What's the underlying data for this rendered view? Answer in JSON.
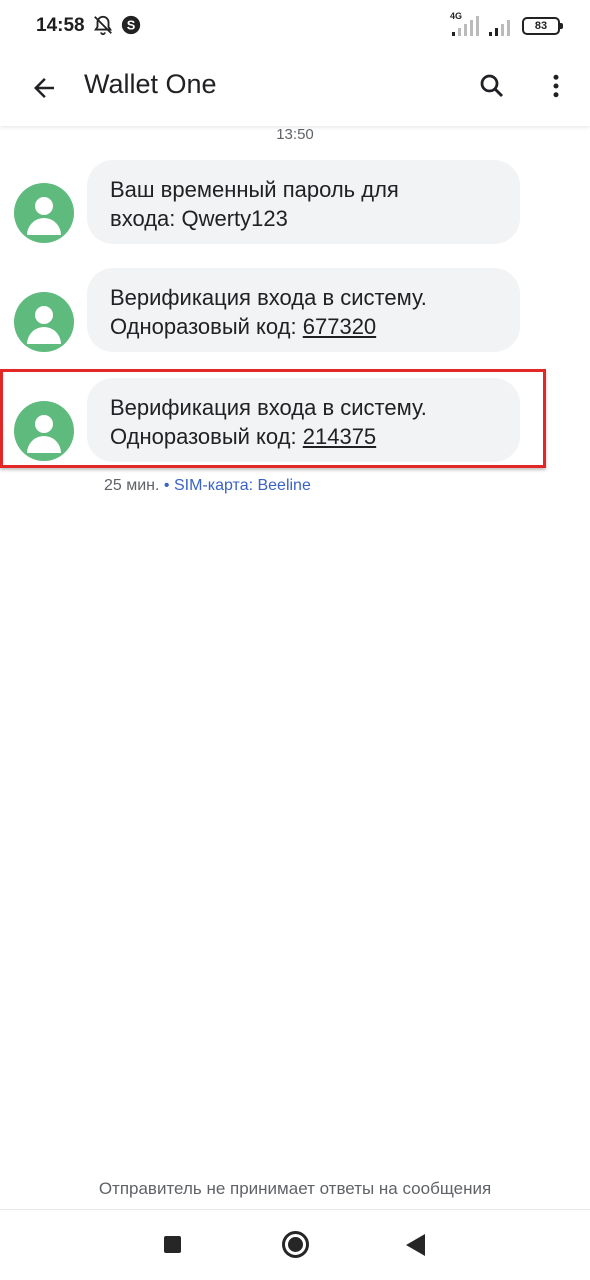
{
  "status_bar": {
    "time": "14:58",
    "network_label": "4G",
    "battery": "83",
    "icons": [
      "alarm-off-icon",
      "skype-icon",
      "signal-icon",
      "signal-icon",
      "battery-icon"
    ]
  },
  "app_bar": {
    "title": "Wallet One",
    "icons": [
      "back-arrow-icon",
      "search-icon",
      "more-vert-icon"
    ]
  },
  "conversation": {
    "date_separator": "13:50",
    "messages": [
      {
        "line1": "Ваш временный пароль для",
        "line2_prefix": "входа: Qwerty123",
        "code": ""
      },
      {
        "line1": "Верификация входа в систему.",
        "line2_prefix": "Одноразовый код: ",
        "code": "677320"
      },
      {
        "line1": "Верификация входа в систему.",
        "line2_prefix": "Одноразовый код: ",
        "code": "214375"
      }
    ],
    "last_message_time": "25 мин.",
    "separator_dot": " • ",
    "sim_label": "SIM-карта: Beeline",
    "footer_note": "Отправитель не принимает ответы на сообщения"
  },
  "colors": {
    "avatar": "#5fba7d",
    "bubble": "#f1f3f4",
    "highlight": "#e32626",
    "sim_text": "#3a63c6"
  },
  "nav_bar": {
    "icons": [
      "recents-square-icon",
      "home-circle-icon",
      "back-triangle-icon"
    ]
  }
}
